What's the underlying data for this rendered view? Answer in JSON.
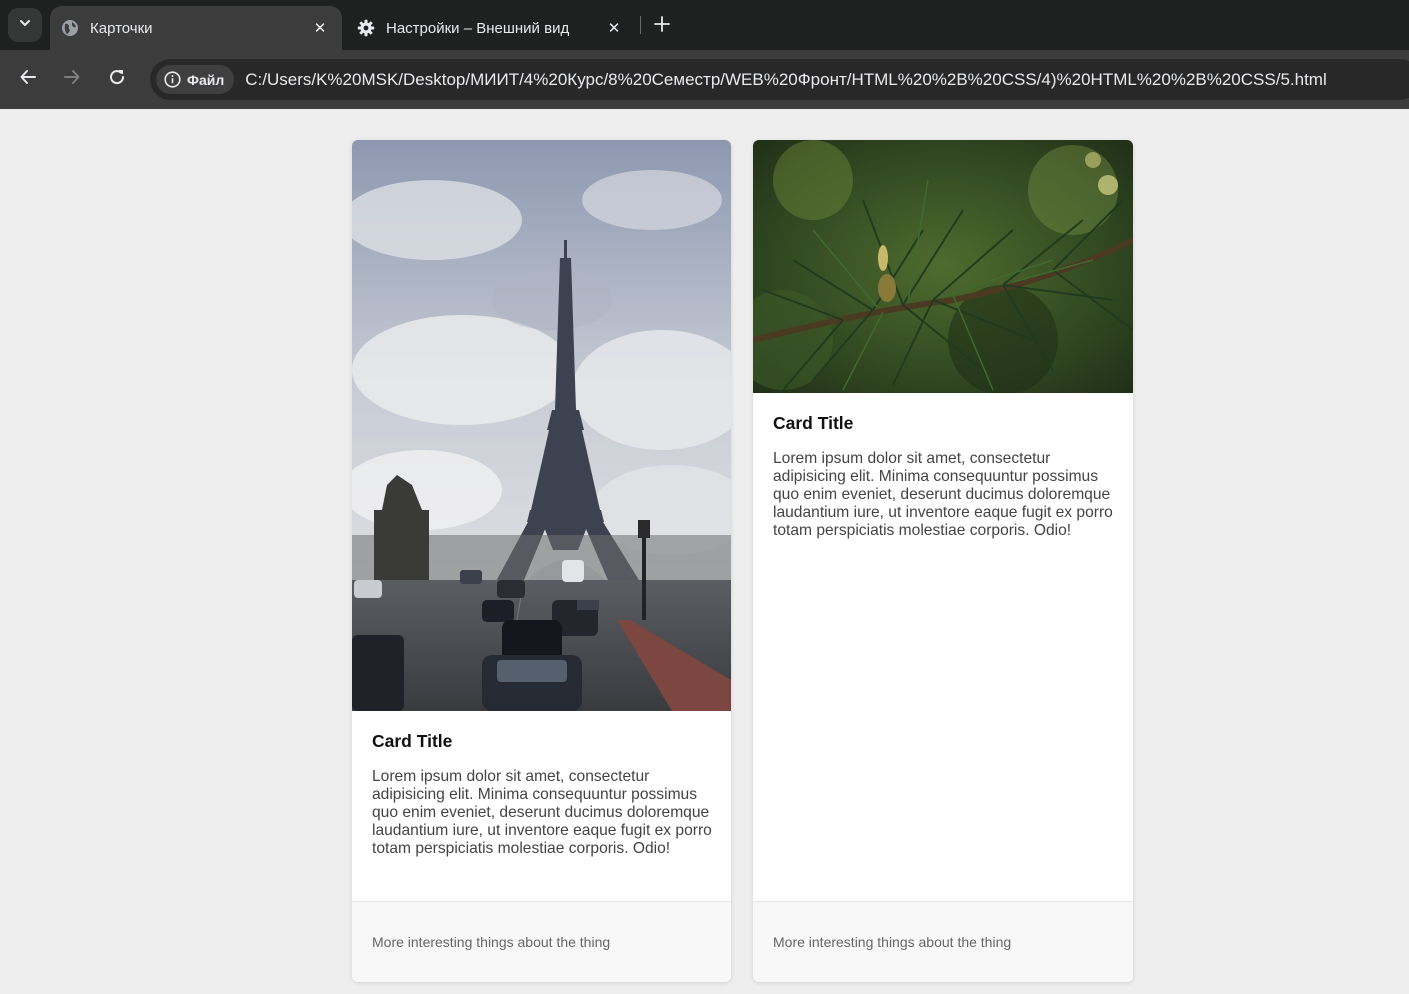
{
  "browser": {
    "tabs": [
      {
        "title": "Карточки",
        "icon": "globe-icon",
        "active": true
      },
      {
        "title": "Настройки – Внешний вид",
        "icon": "gear-icon",
        "active": false
      }
    ],
    "address": {
      "chip_label": "Файл",
      "url": "C:/Users/K%20MSK/Desktop/МИИТ/4%20Курс/8%20Семестр/WEB%20Фронт/HTML%20%2B%20CSS/4)%20HTML%20%2B%20CSS/5.html"
    }
  },
  "cards": [
    {
      "image": "eiffel-tower-photo",
      "title": "Card Title",
      "text": "Lorem ipsum dolor sit amet, consectetur adipisicing elit. Minima consequuntur possimus quo enim eveniet, deserunt ducimus doloremque laudantium iure, ut inventore eaque fugit ex porro totam perspiciatis molestiae corporis. Odio!",
      "footer": "More interesting things about the thing"
    },
    {
      "image": "pine-branch-photo",
      "title": "Card Title",
      "text": "Lorem ipsum dolor sit amet, consectetur adipisicing elit. Minima consequuntur possimus quo enim eveniet, deserunt ducimus doloremque laudantium iure, ut inventore eaque fugit ex porro totam perspiciatis molestiae corporis. Odio!",
      "footer": "More interesting things about the thing"
    }
  ],
  "colors": {
    "page_background": "#eeeeee",
    "tabbar": "#1f2020",
    "toolbar": "#3c3c3c",
    "card_footer": "#f8f8f8"
  }
}
